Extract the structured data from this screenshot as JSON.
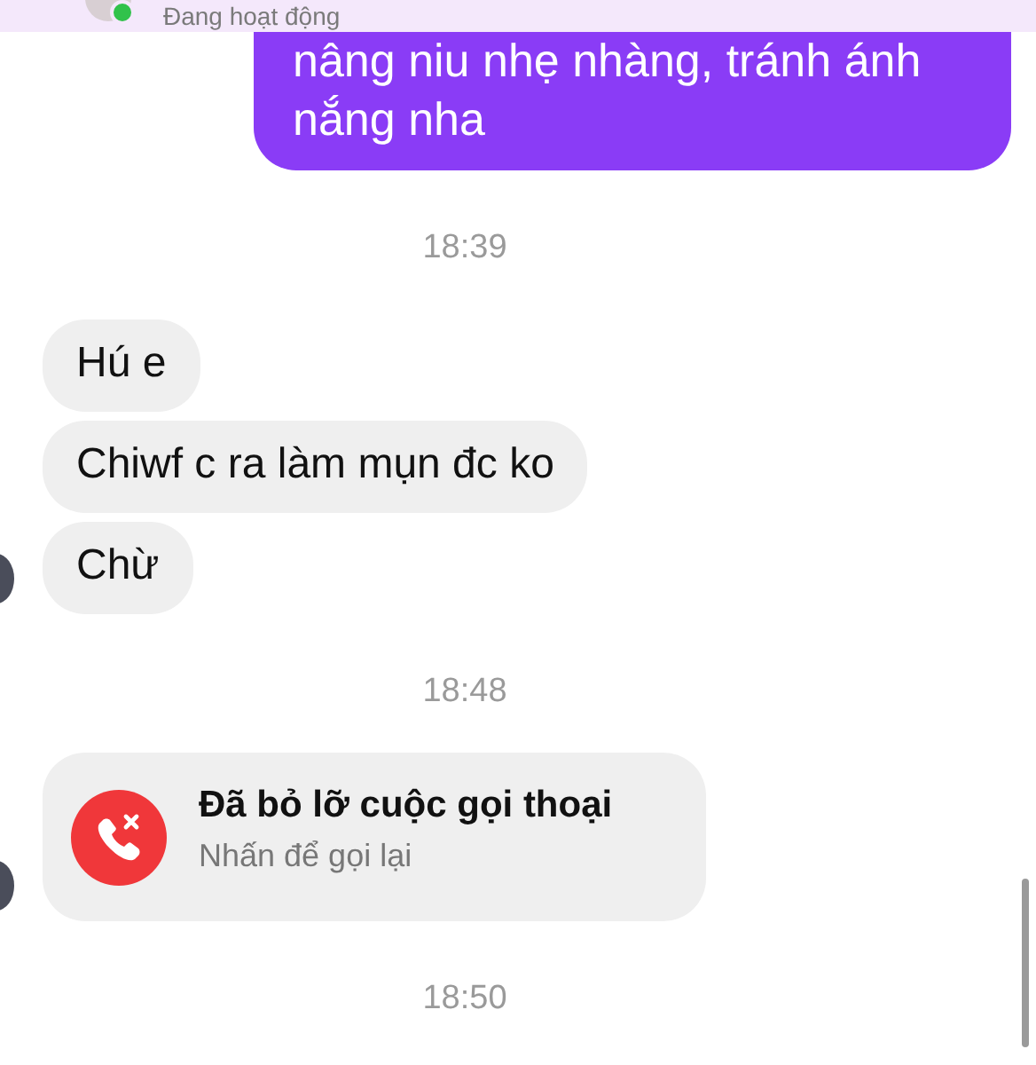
{
  "header": {
    "status": "Đang hoạt động",
    "online": true
  },
  "messages": [
    {
      "kind": "outgoing",
      "text": "nâng niu nhẹ nhàng, tránh ánh nắng nha"
    },
    {
      "kind": "time",
      "text": "18:39"
    },
    {
      "kind": "incoming",
      "text": "Hú e",
      "avatar": false
    },
    {
      "kind": "incoming",
      "text": "Chiwf c ra làm mụn đc ko",
      "avatar": false
    },
    {
      "kind": "incoming",
      "text": "Chừ",
      "avatar": true
    },
    {
      "kind": "time",
      "text": "18:48"
    },
    {
      "kind": "missed_call",
      "title": "Đã bỏ lỡ cuộc gọi thoại",
      "subtitle": "Nhấn để gọi lại",
      "avatar": true
    },
    {
      "kind": "time",
      "text": "18:50"
    }
  ]
}
